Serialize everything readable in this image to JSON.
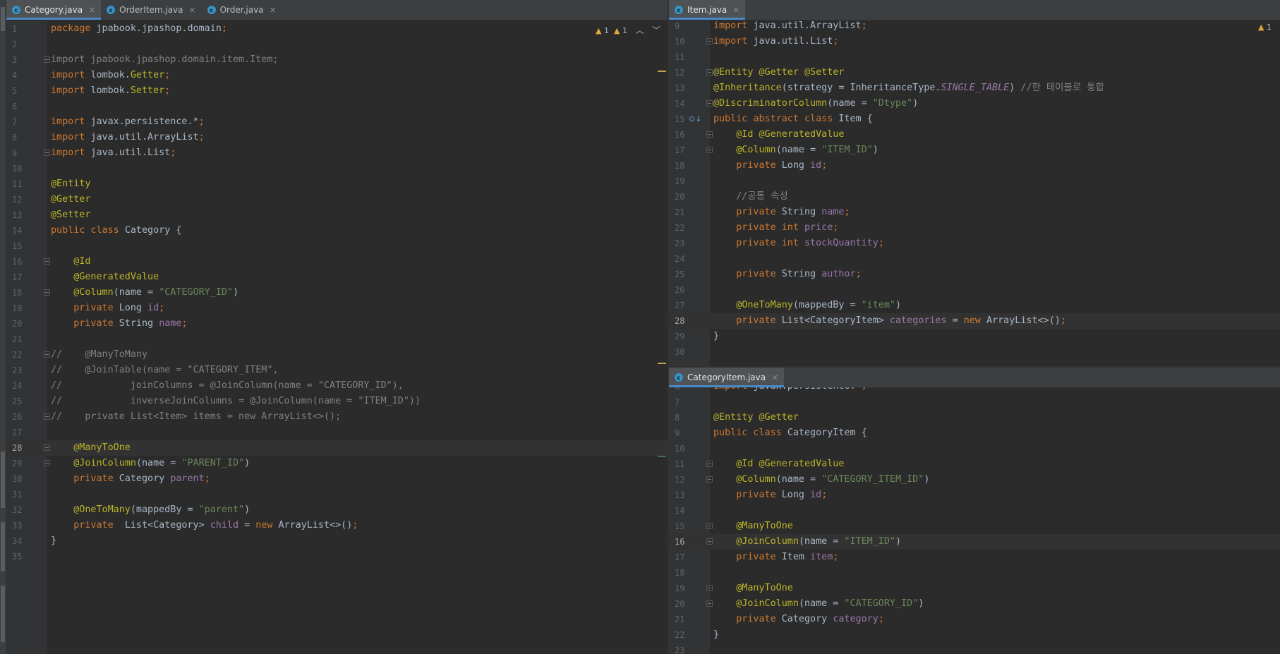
{
  "left_pane": {
    "tabs": [
      {
        "label": "Category.java",
        "icon": "class-icon",
        "active": true
      },
      {
        "label": "OrderItem.java",
        "icon": "class-icon",
        "active": false
      },
      {
        "label": "Order.java",
        "icon": "class-icon",
        "active": false
      }
    ],
    "inspection": {
      "warnings": "1",
      "weak_warnings": "1"
    },
    "current_line": "28",
    "lines": [
      {
        "n": "1",
        "fold": false,
        "s": [
          [
            "kw",
            "package "
          ],
          [
            "pl",
            "jpabook.jpashop.domain"
          ],
          [
            "kw",
            ";"
          ]
        ]
      },
      {
        "n": "2",
        "fold": false,
        "s": []
      },
      {
        "n": "3",
        "fold": true,
        "s": [
          [
            "gray",
            "import jpabook.jpashop.domain.item.Item;"
          ]
        ]
      },
      {
        "n": "4",
        "fold": false,
        "s": [
          [
            "kw",
            "import "
          ],
          [
            "pl",
            "lombok."
          ],
          [
            "an",
            "Getter"
          ],
          [
            "kw",
            ";"
          ]
        ]
      },
      {
        "n": "5",
        "fold": false,
        "s": [
          [
            "kw",
            "import "
          ],
          [
            "pl",
            "lombok."
          ],
          [
            "an",
            "Setter"
          ],
          [
            "kw",
            ";"
          ]
        ]
      },
      {
        "n": "6",
        "fold": false,
        "s": []
      },
      {
        "n": "7",
        "fold": false,
        "s": [
          [
            "kw",
            "import "
          ],
          [
            "pl",
            "javax.persistence.*"
          ],
          [
            "kw",
            ";"
          ]
        ]
      },
      {
        "n": "8",
        "fold": false,
        "s": [
          [
            "kw",
            "import "
          ],
          [
            "pl",
            "java.util.ArrayList"
          ],
          [
            "kw",
            ";"
          ]
        ]
      },
      {
        "n": "9",
        "fold": true,
        "s": [
          [
            "kw",
            "import "
          ],
          [
            "pl",
            "java.util.List"
          ],
          [
            "kw",
            ";"
          ]
        ]
      },
      {
        "n": "10",
        "fold": false,
        "s": []
      },
      {
        "n": "11",
        "fold": false,
        "s": [
          [
            "an",
            "@Entity"
          ]
        ]
      },
      {
        "n": "12",
        "fold": false,
        "s": [
          [
            "an",
            "@Getter"
          ]
        ]
      },
      {
        "n": "13",
        "fold": false,
        "s": [
          [
            "an",
            "@Setter"
          ]
        ]
      },
      {
        "n": "14",
        "fold": false,
        "s": [
          [
            "kw",
            "public class "
          ],
          [
            "pl",
            "Category {"
          ]
        ]
      },
      {
        "n": "15",
        "fold": false,
        "s": []
      },
      {
        "n": "16",
        "fold": true,
        "s": [
          [
            "pl",
            "    "
          ],
          [
            "an",
            "@Id"
          ]
        ]
      },
      {
        "n": "17",
        "fold": false,
        "s": [
          [
            "pl",
            "    "
          ],
          [
            "an",
            "@GeneratedValue"
          ]
        ]
      },
      {
        "n": "18",
        "fold": true,
        "s": [
          [
            "pl",
            "    "
          ],
          [
            "an",
            "@Column"
          ],
          [
            "pl",
            "(name = "
          ],
          [
            "str",
            "\"CATEGORY_ID\""
          ],
          [
            "pl",
            ")"
          ]
        ]
      },
      {
        "n": "19",
        "fold": false,
        "s": [
          [
            "pl",
            "    "
          ],
          [
            "kw",
            "private "
          ],
          [
            "pl",
            "Long "
          ],
          [
            "fld",
            "id"
          ],
          [
            "kw",
            ";"
          ]
        ]
      },
      {
        "n": "20",
        "fold": false,
        "s": [
          [
            "pl",
            "    "
          ],
          [
            "kw",
            "private "
          ],
          [
            "pl",
            "String "
          ],
          [
            "fld",
            "name"
          ],
          [
            "kw",
            ";"
          ]
        ]
      },
      {
        "n": "21",
        "fold": false,
        "s": []
      },
      {
        "n": "22",
        "fold": true,
        "s": [
          [
            "cm",
            "//    @ManyToMany"
          ]
        ]
      },
      {
        "n": "23",
        "fold": false,
        "s": [
          [
            "cm",
            "//    @JoinTable(name = \"CATEGORY_ITEM\","
          ]
        ]
      },
      {
        "n": "24",
        "fold": false,
        "s": [
          [
            "cm",
            "//            joinColumns = @JoinColumn(name = \"CATEGORY_ID\"),"
          ]
        ]
      },
      {
        "n": "25",
        "fold": false,
        "s": [
          [
            "cm",
            "//            inverseJoinColumns = @JoinColumn(name = \"ITEM_ID\"))"
          ]
        ]
      },
      {
        "n": "26",
        "fold": true,
        "s": [
          [
            "cm",
            "//    private List<Item> items = new ArrayList<>();"
          ]
        ]
      },
      {
        "n": "27",
        "fold": false,
        "s": []
      },
      {
        "n": "28",
        "fold": true,
        "s": [
          [
            "pl",
            "    "
          ],
          [
            "an",
            "@ManyToOne"
          ]
        ]
      },
      {
        "n": "29",
        "fold": true,
        "s": [
          [
            "pl",
            "    "
          ],
          [
            "an",
            "@JoinColumn"
          ],
          [
            "pl",
            "(name = "
          ],
          [
            "str",
            "\"PARENT_ID\""
          ],
          [
            "pl",
            ")"
          ]
        ]
      },
      {
        "n": "30",
        "fold": false,
        "s": [
          [
            "pl",
            "    "
          ],
          [
            "kw",
            "private "
          ],
          [
            "pl",
            "Category "
          ],
          [
            "fld",
            "parent"
          ],
          [
            "kw",
            ";"
          ]
        ]
      },
      {
        "n": "31",
        "fold": false,
        "s": []
      },
      {
        "n": "32",
        "fold": false,
        "s": [
          [
            "pl",
            "    "
          ],
          [
            "an",
            "@OneToMany"
          ],
          [
            "pl",
            "(mappedBy = "
          ],
          [
            "str",
            "\"parent\""
          ],
          [
            "pl",
            ")"
          ]
        ]
      },
      {
        "n": "33",
        "fold": false,
        "s": [
          [
            "pl",
            "    "
          ],
          [
            "kw",
            "private  "
          ],
          [
            "pl",
            "List<Category> "
          ],
          [
            "fld",
            "child"
          ],
          [
            "pl",
            " = "
          ],
          [
            "kw",
            "new "
          ],
          [
            "pl",
            "ArrayList<>()"
          ],
          [
            "kw",
            ";"
          ]
        ]
      },
      {
        "n": "34",
        "fold": false,
        "s": [
          [
            "pl",
            "}"
          ]
        ]
      },
      {
        "n": "35",
        "fold": false,
        "s": []
      }
    ]
  },
  "right_top_pane": {
    "tabs": [
      {
        "label": "Item.java",
        "icon": "abstract-class-icon",
        "active": true
      }
    ],
    "inspection": {
      "warnings": "1"
    },
    "current_line": "28",
    "lines": [
      {
        "n": "9",
        "fold": false,
        "s": [
          [
            "kw",
            "import "
          ],
          [
            "pl",
            "java.util.ArrayList"
          ],
          [
            "kw",
            ";"
          ]
        ]
      },
      {
        "n": "10",
        "fold": true,
        "s": [
          [
            "kw",
            "import "
          ],
          [
            "pl",
            "java.util.List"
          ],
          [
            "kw",
            ";"
          ]
        ]
      },
      {
        "n": "11",
        "fold": false,
        "s": []
      },
      {
        "n": "12",
        "fold": true,
        "s": [
          [
            "an",
            "@Entity @Getter @Setter"
          ]
        ]
      },
      {
        "n": "13",
        "fold": false,
        "s": [
          [
            "an",
            "@Inheritance"
          ],
          [
            "pl",
            "(strategy = InheritanceType."
          ],
          [
            "it",
            "SINGLE_TABLE"
          ],
          [
            "pl",
            ") "
          ],
          [
            "cm",
            "//한 테이블로 통합"
          ]
        ]
      },
      {
        "n": "14",
        "fold": true,
        "s": [
          [
            "an",
            "@DiscriminatorColumn"
          ],
          [
            "pl",
            "(name = "
          ],
          [
            "str",
            "\"Dtype\""
          ],
          [
            "pl",
            ")"
          ]
        ]
      },
      {
        "n": "15",
        "fold": false,
        "s": [
          [
            "kw",
            "public abstract class "
          ],
          [
            "pl",
            "Item {"
          ]
        ]
      },
      {
        "n": "16",
        "fold": true,
        "s": [
          [
            "pl",
            "    "
          ],
          [
            "an",
            "@Id @GeneratedValue"
          ]
        ]
      },
      {
        "n": "17",
        "fold": true,
        "s": [
          [
            "pl",
            "    "
          ],
          [
            "an",
            "@Column"
          ],
          [
            "pl",
            "(name = "
          ],
          [
            "str",
            "\"ITEM_ID\""
          ],
          [
            "pl",
            ")"
          ]
        ]
      },
      {
        "n": "18",
        "fold": false,
        "s": [
          [
            "pl",
            "    "
          ],
          [
            "kw",
            "private "
          ],
          [
            "pl",
            "Long "
          ],
          [
            "fld",
            "id"
          ],
          [
            "kw",
            ";"
          ]
        ]
      },
      {
        "n": "19",
        "fold": false,
        "s": []
      },
      {
        "n": "20",
        "fold": false,
        "s": [
          [
            "pl",
            "    "
          ],
          [
            "cm",
            "//공통 속성"
          ]
        ]
      },
      {
        "n": "21",
        "fold": false,
        "s": [
          [
            "pl",
            "    "
          ],
          [
            "kw",
            "private "
          ],
          [
            "pl",
            "String "
          ],
          [
            "fld",
            "name"
          ],
          [
            "kw",
            ";"
          ]
        ]
      },
      {
        "n": "22",
        "fold": false,
        "s": [
          [
            "pl",
            "    "
          ],
          [
            "kw",
            "private int "
          ],
          [
            "fld",
            "price"
          ],
          [
            "kw",
            ";"
          ]
        ]
      },
      {
        "n": "23",
        "fold": false,
        "s": [
          [
            "pl",
            "    "
          ],
          [
            "kw",
            "private int "
          ],
          [
            "fld",
            "stockQuantity"
          ],
          [
            "kw",
            ";"
          ]
        ]
      },
      {
        "n": "24",
        "fold": false,
        "s": []
      },
      {
        "n": "25",
        "fold": false,
        "s": [
          [
            "pl",
            "    "
          ],
          [
            "kw",
            "private "
          ],
          [
            "pl",
            "String "
          ],
          [
            "fld",
            "author"
          ],
          [
            "kw",
            ";"
          ]
        ]
      },
      {
        "n": "26",
        "fold": false,
        "s": []
      },
      {
        "n": "27",
        "fold": false,
        "s": [
          [
            "pl",
            "    "
          ],
          [
            "an",
            "@OneToMany"
          ],
          [
            "pl",
            "(mappedBy = "
          ],
          [
            "str",
            "\"item\""
          ],
          [
            "pl",
            ")"
          ]
        ]
      },
      {
        "n": "28",
        "fold": false,
        "s": [
          [
            "pl",
            "    "
          ],
          [
            "kw",
            "private "
          ],
          [
            "pl",
            "List<CategoryItem> "
          ],
          [
            "fld",
            "categories"
          ],
          [
            "pl",
            " = "
          ],
          [
            "kw",
            "new "
          ],
          [
            "pl",
            "ArrayList<>()"
          ],
          [
            "kw",
            ";"
          ]
        ]
      },
      {
        "n": "29",
        "fold": false,
        "s": [
          [
            "pl",
            "}"
          ]
        ]
      },
      {
        "n": "30",
        "fold": false,
        "s": []
      }
    ]
  },
  "right_bottom_pane": {
    "tabs": [
      {
        "label": "CategoryItem.java",
        "icon": "class-icon",
        "active": true
      }
    ],
    "current_line": "16",
    "lines": [
      {
        "n": "6",
        "fold": false,
        "s": [
          [
            "kw",
            "import "
          ],
          [
            "pl",
            "javax.persistence.*"
          ],
          [
            "kw",
            ";"
          ]
        ]
      },
      {
        "n": "7",
        "fold": false,
        "s": []
      },
      {
        "n": "8",
        "fold": false,
        "s": [
          [
            "an",
            "@Entity @Getter"
          ]
        ]
      },
      {
        "n": "9",
        "fold": false,
        "s": [
          [
            "kw",
            "public class "
          ],
          [
            "pl",
            "CategoryItem {"
          ]
        ]
      },
      {
        "n": "10",
        "fold": false,
        "s": []
      },
      {
        "n": "11",
        "fold": true,
        "s": [
          [
            "pl",
            "    "
          ],
          [
            "an",
            "@Id @GeneratedValue"
          ]
        ]
      },
      {
        "n": "12",
        "fold": true,
        "s": [
          [
            "pl",
            "    "
          ],
          [
            "an",
            "@Column"
          ],
          [
            "pl",
            "(name = "
          ],
          [
            "str",
            "\"CATEGORY_ITEM_ID\""
          ],
          [
            "pl",
            ")"
          ]
        ]
      },
      {
        "n": "13",
        "fold": false,
        "s": [
          [
            "pl",
            "    "
          ],
          [
            "kw",
            "private "
          ],
          [
            "pl",
            "Long "
          ],
          [
            "fld",
            "id"
          ],
          [
            "kw",
            ";"
          ]
        ]
      },
      {
        "n": "14",
        "fold": false,
        "s": []
      },
      {
        "n": "15",
        "fold": true,
        "s": [
          [
            "pl",
            "    "
          ],
          [
            "an",
            "@ManyToOne"
          ]
        ]
      },
      {
        "n": "16",
        "fold": true,
        "s": [
          [
            "pl",
            "    "
          ],
          [
            "an",
            "@JoinColumn"
          ],
          [
            "pl",
            "(name = "
          ],
          [
            "str",
            "\"ITEM_ID\""
          ],
          [
            "pl",
            ")"
          ]
        ]
      },
      {
        "n": "17",
        "fold": false,
        "s": [
          [
            "pl",
            "    "
          ],
          [
            "kw",
            "private "
          ],
          [
            "pl",
            "Item "
          ],
          [
            "fld",
            "item"
          ],
          [
            "kw",
            ";"
          ]
        ]
      },
      {
        "n": "18",
        "fold": false,
        "s": []
      },
      {
        "n": "19",
        "fold": true,
        "s": [
          [
            "pl",
            "    "
          ],
          [
            "an",
            "@ManyToOne"
          ]
        ]
      },
      {
        "n": "20",
        "fold": true,
        "s": [
          [
            "pl",
            "    "
          ],
          [
            "an",
            "@JoinColumn"
          ],
          [
            "pl",
            "(name = "
          ],
          [
            "str",
            "\"CATEGORY_ID\""
          ],
          [
            "pl",
            ")"
          ]
        ]
      },
      {
        "n": "21",
        "fold": false,
        "s": [
          [
            "pl",
            "    "
          ],
          [
            "kw",
            "private "
          ],
          [
            "pl",
            "Category "
          ],
          [
            "fld",
            "category"
          ],
          [
            "kw",
            ";"
          ]
        ]
      },
      {
        "n": "22",
        "fold": false,
        "s": [
          [
            "pl",
            "}"
          ]
        ]
      },
      {
        "n": "23",
        "fold": false,
        "s": []
      }
    ]
  },
  "colors": {
    "background": "#2b2b2b",
    "gutter": "#313335",
    "keyword": "#cc7832",
    "annotation": "#bbb529",
    "string": "#6a8759",
    "field": "#9876aa",
    "comment": "#808080",
    "plain": "#a9b7c6",
    "tab_active_underline": "#4a88c7",
    "current_line": "#323232"
  }
}
